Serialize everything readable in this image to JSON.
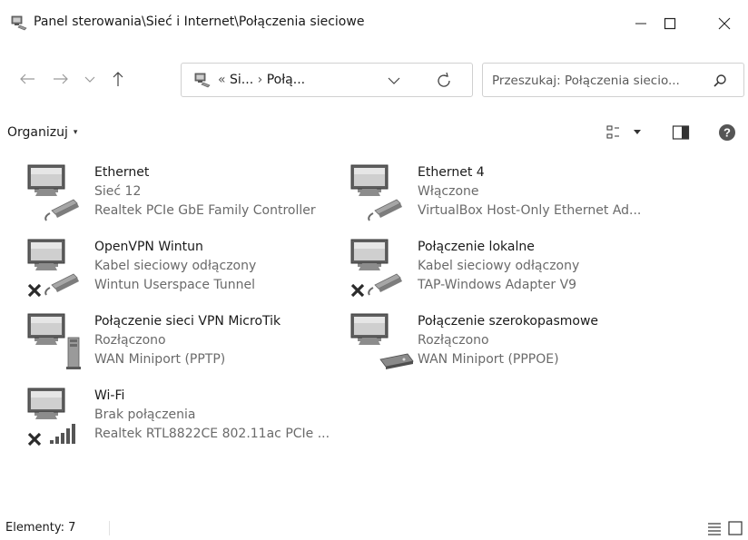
{
  "window": {
    "title": "Panel sterowania\\Sieć i Internet\\Połączenia sieciowe"
  },
  "address": {
    "overflow": "«",
    "crumb1": "Si...",
    "separator": "›",
    "crumb2": "Połą..."
  },
  "search": {
    "placeholder": "Przeszukaj: Połączenia siecio..."
  },
  "toolbar": {
    "organize_label": "Organizuj",
    "organize_caret": "▾"
  },
  "connections": [
    {
      "name": "Ethernet",
      "status": "Sieć 12",
      "device": "Realtek PCIe GbE Family Controller",
      "icon": "ethernet-cable-icon",
      "disconnected": false
    },
    {
      "name": "Ethernet 4",
      "status": "Włączone",
      "device": "VirtualBox Host-Only Ethernet Ad...",
      "icon": "ethernet-cable-icon",
      "disconnected": false
    },
    {
      "name": "OpenVPN Wintun",
      "status": "Kabel sieciowy odłączony",
      "device": "Wintun Userspace Tunnel",
      "icon": "ethernet-cable-icon",
      "disconnected": true
    },
    {
      "name": "Połączenie lokalne",
      "status": "Kabel sieciowy odłączony",
      "device": "TAP-Windows Adapter V9",
      "icon": "ethernet-cable-icon",
      "disconnected": true
    },
    {
      "name": "Połączenie sieci VPN MicroTik",
      "status": "Rozłączono",
      "device": "WAN Miniport (PPTP)",
      "icon": "vpn-tower-icon",
      "disconnected": false
    },
    {
      "name": "Połączenie szerokopasmowe",
      "status": "Rozłączono",
      "device": "WAN Miniport (PPPOE)",
      "icon": "modem-icon",
      "disconnected": false
    },
    {
      "name": "Wi-Fi",
      "status": "Brak połączenia",
      "device": "Realtek RTL8822CE 802.11ac PCIe ...",
      "icon": "wifi-signal-icon",
      "disconnected": true
    }
  ],
  "statusbar": {
    "count_label": "Elementy: 7"
  }
}
